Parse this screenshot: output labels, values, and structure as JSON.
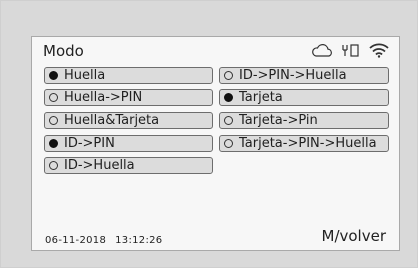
{
  "screen": {
    "title": "Modo",
    "options": [
      {
        "label": "Huella",
        "selected": true
      },
      {
        "label": "Huella->PIN",
        "selected": false
      },
      {
        "label": "Huella&Tarjeta",
        "selected": false
      },
      {
        "label": "ID->PIN",
        "selected": true
      },
      {
        "label": "ID->Huella",
        "selected": false
      },
      {
        "label": "ID->PIN->Huella",
        "selected": false
      },
      {
        "label": "Tarjeta",
        "selected": true
      },
      {
        "label": "Tarjeta->Pin",
        "selected": false
      },
      {
        "label": "Tarjeta->PIN->Huella",
        "selected": false
      }
    ],
    "date": "06-11-2018",
    "time": "13:12:26",
    "back_label": "M/volver"
  },
  "status_icons": [
    "cloud-icon",
    "usb-icon",
    "wifi-icon"
  ]
}
